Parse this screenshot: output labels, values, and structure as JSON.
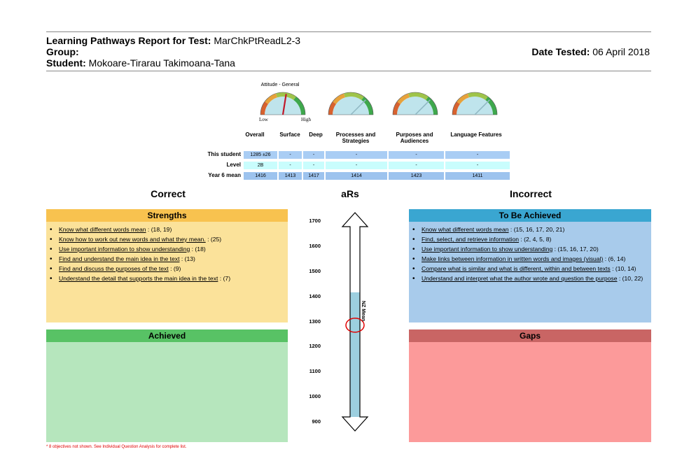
{
  "header": {
    "report_label": "Learning Pathways Report for Test:",
    "test_name": "MarChkPtReadL2-3",
    "group_label": "Group:",
    "group_value": "",
    "student_label": "Student:",
    "student_name": "Mokoare-Tirarau Takimoana-Tana",
    "date_label": "Date Tested:",
    "date_value": "06 April 2018"
  },
  "gauges": {
    "title": "Attitude - General",
    "low": "Low",
    "high": "High",
    "items": [
      {
        "value": 0.55,
        "title_shown": true
      },
      {
        "value": 0.75
      },
      {
        "value": 0.75
      },
      {
        "value": 0.75
      }
    ]
  },
  "table": {
    "columns": [
      "Overall",
      "Surface",
      "Deep",
      "Processes and Strategies",
      "Purposes and Audiences",
      "Language Features"
    ],
    "rows": [
      {
        "label": "This student",
        "cells": [
          "1285 ±26",
          "-",
          "-",
          "-",
          "-",
          "-"
        ]
      },
      {
        "label": "Level",
        "cells": [
          "2B",
          "-",
          "-",
          "-",
          "-",
          "-"
        ]
      },
      {
        "label": "Year 6 mean",
        "cells": [
          "1416",
          "1413",
          "1417",
          "1414",
          "1423",
          "1411"
        ]
      }
    ]
  },
  "sections": {
    "correct": "Correct",
    "ars": "aRs",
    "incorrect": "Incorrect"
  },
  "strengths": {
    "title": "Strengths",
    "items": [
      {
        "text": "Know what different words mean",
        "refs": " : (18, 19)"
      },
      {
        "text": "Know how to work out new words and what they mean.",
        "refs": " : (25)"
      },
      {
        "text": "Use important information to show understanding",
        "refs": " : (18)"
      },
      {
        "text": "Find and understand the main idea in the text",
        "refs": " : (13)"
      },
      {
        "text": "Find and discuss the purposes of the text",
        "refs": " : (9)"
      },
      {
        "text": "Understand the detail that supports the main idea in the text",
        "refs": " : (7)"
      }
    ]
  },
  "achieved": {
    "title": "Achieved"
  },
  "to_be_achieved": {
    "title": "To Be Achieved",
    "items": [
      {
        "text": "Know what different words mean",
        "refs": " : (15, 16, 17, 20, 21)"
      },
      {
        "text": "Find, select, and retrieve information",
        "refs": " : (2, 4, 5, 8)"
      },
      {
        "text": "Use important information to show understanding",
        "refs": " : (15, 16, 17, 20)"
      },
      {
        "text": "Make links between information in written words and images (visual)",
        "refs": " : (6, 14)"
      },
      {
        "text": "Compare what is similar and what is different, within and between texts",
        "refs": " : (10, 14)"
      },
      {
        "text": "Understand and interpret what the author wrote and question the purpose",
        "refs": " : (10, 22)"
      }
    ]
  },
  "gaps": {
    "title": "Gaps"
  },
  "scale": {
    "ticks": [
      "1700",
      "1600",
      "1500",
      "1400",
      "1300",
      "1200",
      "1100",
      "1000",
      "900"
    ],
    "mean_label": "NZ Mean",
    "mean_value": 1416,
    "student_value": 1285
  },
  "footnote": "* 8 objectives not shown. See Individual Question Analysis for complete list.",
  "colors": {
    "strengths": "#f8c24f",
    "strengths_body": "#fbe29a",
    "achieved": "#58c265",
    "achieved_body": "#b6e6bd",
    "to_be_achieved": "#3aa6d1",
    "to_be_achieved_body": "#a8cbeb",
    "gaps": "#c96564",
    "gaps_body": "#fc9a9a",
    "scale_fill": "#9ccfdf"
  }
}
